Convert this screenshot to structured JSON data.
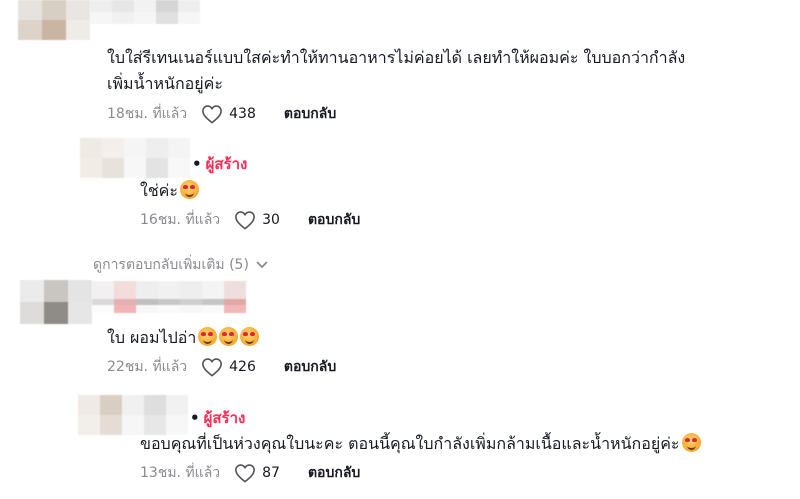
{
  "comments": [
    {
      "text_line1": "ใบใส่รีเทนเนอร์แบบใสค่ะทำให้ทานอาหารไม่ค่อยได้ เลยทำให้ผอมค่ะ ใบบอกว่ากำลัง",
      "text_line2": "เพิ่มน้ำหนักอยู่ค่ะ",
      "time": "18ชม. ที่แล้ว",
      "likes": "438",
      "reply_label": "ตอบกลับ"
    },
    {
      "creator_label": "ผู้สร้าง",
      "text": "ใช่ค่ะ",
      "time": "16ชม. ที่แล้ว",
      "likes": "30",
      "reply_label": "ตอบกลับ"
    },
    {
      "text": "ใบ ผอมไปอ่า",
      "time": "22ชม. ที่แล้ว",
      "likes": "426",
      "reply_label": "ตอบกลับ"
    },
    {
      "creator_label": "ผู้สร้าง",
      "text": "ขอบคุณที่เป็นห่วงคุณใบนะคะ ตอนนี้คุณใบกำลังเพิ่มกล้ามเนื้อและน้ำหนักอยู่ค่ะ",
      "time": "13ชม. ที่แล้ว",
      "likes": "87",
      "reply_label": "ตอบกลับ"
    }
  ],
  "more_replies_label": "ดูการตอบกลับเพิ่มเติม (5)",
  "icons": {
    "like": "heart-outline-icon",
    "expand": "chevron-down-icon",
    "emoji": "smiling-face-with-hearts-emoji"
  },
  "colors": {
    "creator": "#fe2c55",
    "meta": "#8a8b91",
    "text": "#161823"
  }
}
